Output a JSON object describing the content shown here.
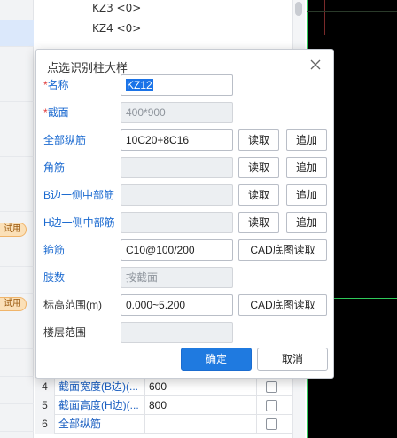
{
  "tree": {
    "nodes": [
      "KZ3 <0>",
      "KZ4 <0>"
    ]
  },
  "left_strip": {
    "badges": [
      "试用",
      "试用"
    ]
  },
  "dialog": {
    "title": "点选识别柱大样",
    "fields": {
      "name": {
        "label": "名称",
        "required": true,
        "value": "KZ12"
      },
      "section": {
        "label": "截面",
        "required": true,
        "placeholder": "400*900"
      },
      "all_rebar": {
        "label": "全部纵筋",
        "value": "10C20+8C16",
        "read": "读取",
        "append": "追加"
      },
      "corner_rebar": {
        "label": "角筋",
        "value": "",
        "read": "读取",
        "append": "追加"
      },
      "b_side_rebar": {
        "label": "B边一侧中部筋",
        "value": "",
        "read": "读取",
        "append": "追加"
      },
      "h_side_rebar": {
        "label": "H边一侧中部筋",
        "value": "",
        "read": "读取",
        "append": "追加"
      },
      "stirrup": {
        "label": "箍筋",
        "value": "C10@100/200",
        "cad_read": "CAD底图读取"
      },
      "leg_count": {
        "label": "肢数",
        "placeholder": "按截面"
      },
      "elevation": {
        "label": "标高范围(m)",
        "value": "0.000~5.200",
        "cad_read": "CAD底图读取"
      },
      "floor_range": {
        "label": "楼层范围",
        "value": ""
      }
    },
    "ok_label": "确定",
    "cancel_label": "取消"
  },
  "grid": {
    "rows": [
      {
        "num": "4",
        "name": "截面宽度(B边)(...",
        "value": "600"
      },
      {
        "num": "5",
        "name": "截面高度(H边)(...",
        "value": "800"
      },
      {
        "num": "6",
        "name": "全部纵筋",
        "value": ""
      }
    ]
  },
  "colors": {
    "accent": "#1f7ae0",
    "label_blue": "#1b6ad0",
    "required_star": "#e03b3b",
    "canvas_bg": "#000000",
    "canvas_line": "#2fc95a"
  }
}
